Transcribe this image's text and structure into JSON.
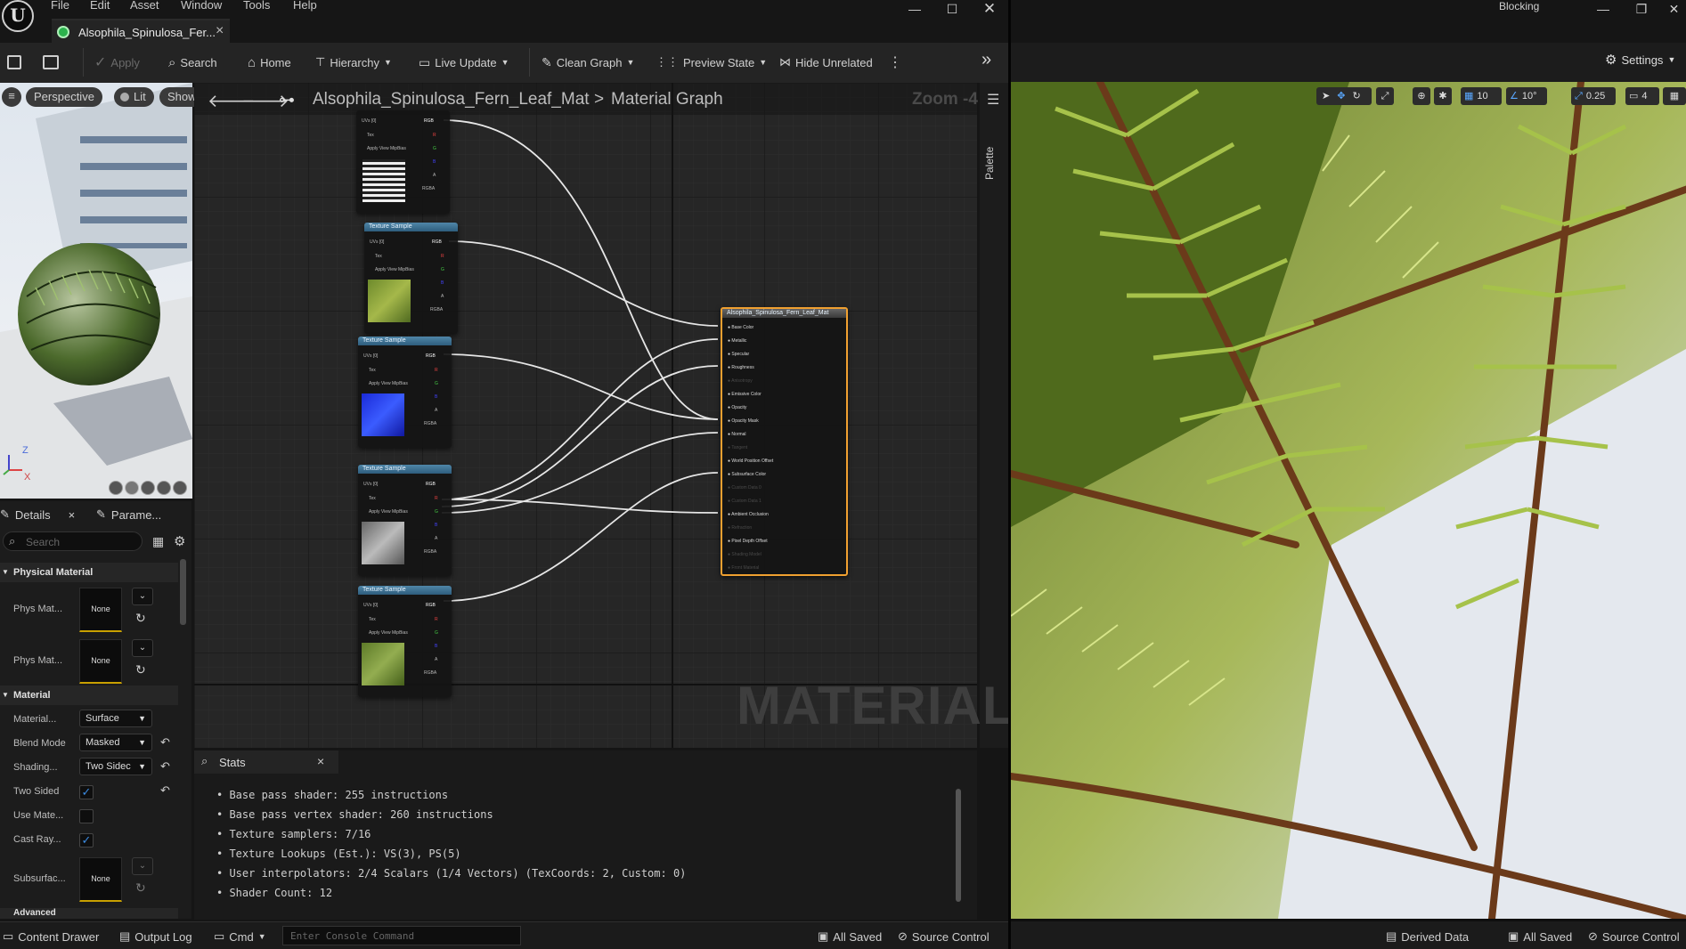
{
  "menu": {
    "file": "File",
    "edit": "Edit",
    "asset": "Asset",
    "window": "Window",
    "tools": "Tools",
    "help": "Help"
  },
  "tab": {
    "title": "Alsophila_Spinulosa_Fer...",
    "close": "×"
  },
  "toolbar": {
    "apply": "Apply",
    "search": "Search",
    "home": "Home",
    "hierarchy": "Hierarchy",
    "live_update": "Live Update",
    "clean_graph": "Clean Graph",
    "preview_state": "Preview State",
    "hide_unrelated": "Hide Unrelated"
  },
  "preview": {
    "perspective": "Perspective",
    "lit": "Lit",
    "show": "Show",
    "axis_z": "Z",
    "axis_x": "X"
  },
  "breadcrumb": {
    "asset": "Alsophila_Spinulosa_Fern_Leaf_Mat",
    "sep": ">",
    "graph": "Material Graph",
    "zoom": "Zoom -4",
    "palette": "Palette"
  },
  "watermark": "MATERIAL",
  "details": {
    "tab_details": "Details",
    "tab_close": "×",
    "tab_params": "Parame...",
    "search_placeholder": "Search",
    "section_physical": "Physical Material",
    "phys1": "Phys Mat...",
    "phys2": "Phys Mat...",
    "none": "None",
    "section_material": "Material",
    "material_domain": "Material...",
    "material_domain_val": "Surface",
    "blend_mode": "Blend Mode",
    "blend_mode_val": "Masked",
    "shading": "Shading...",
    "shading_val": "Two Sidec",
    "two_sided": "Two Sided",
    "use_mate": "Use Mate...",
    "cast_ray": "Cast Ray...",
    "subsurface": "Subsurfac...",
    "advanced": "Advanced"
  },
  "nodes": {
    "texture_sample": "Texture Sample",
    "uvs": "UVs",
    "uv_val": "0",
    "tex": "Tex",
    "apply_mip": "Apply View MipBias",
    "rgb": "RGB",
    "r": "R",
    "g": "G",
    "b": "B",
    "a": "A",
    "rgba": "RGBA",
    "result_title": "Alsophila_Spinulosa_Fern_Leaf_Mat",
    "inputs": [
      "Base Color",
      "Metallic",
      "Specular",
      "Roughness",
      "Anisotropy",
      "Emissive Color",
      "Opacity",
      "Opacity Mask",
      "Normal",
      "Tangent",
      "World Position Offset",
      "Subsurface Color",
      "Custom Data 0",
      "Custom Data 1",
      "Ambient Occlusion",
      "Refraction",
      "Pixel Depth Offset",
      "Shading Model",
      "Front Material"
    ]
  },
  "stats": {
    "tab": "Stats",
    "close": "×",
    "lines": [
      "Base pass shader: 255 instructions",
      "Base pass vertex shader: 260 instructions",
      "Texture samplers: 7/16",
      "Texture Lookups (Est.): VS(3), PS(5)",
      "User interpolators: 2/4 Scalars (1/4 Vectors) (TexCoords: 2, Custom: 0)",
      "Shader Count: 12"
    ]
  },
  "bottombar": {
    "content_drawer": "Content Drawer",
    "output_log": "Output Log",
    "cmd": "Cmd",
    "console_placeholder": "Enter Console Command",
    "all_saved": "All Saved",
    "source_control": "Source Control"
  },
  "viewport": {
    "blocking": "Blocking",
    "settings": "Settings",
    "grid": "10",
    "angle": "10°",
    "scale": "0.25",
    "cam": "4",
    "derived_data": "Derived Data",
    "all_saved": "All Saved",
    "source_control": "Source Control"
  },
  "colors": {
    "accent": "#e8a020",
    "node_header": "#3a6f92",
    "selected": "#f0a030",
    "check": "#3b8ae0"
  }
}
